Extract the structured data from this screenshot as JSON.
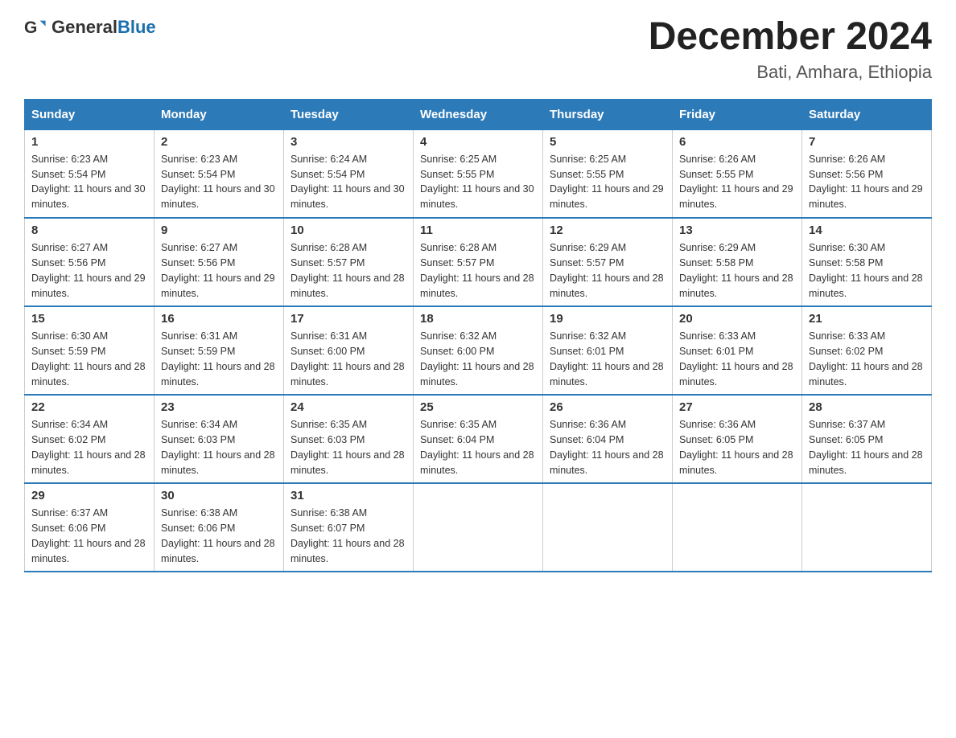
{
  "header": {
    "logo_general": "General",
    "logo_blue": "Blue",
    "month_year": "December 2024",
    "location": "Bati, Amhara, Ethiopia"
  },
  "days_of_week": [
    "Sunday",
    "Monday",
    "Tuesday",
    "Wednesday",
    "Thursday",
    "Friday",
    "Saturday"
  ],
  "weeks": [
    [
      {
        "day": "1",
        "sunrise": "6:23 AM",
        "sunset": "5:54 PM",
        "daylight": "11 hours and 30 minutes."
      },
      {
        "day": "2",
        "sunrise": "6:23 AM",
        "sunset": "5:54 PM",
        "daylight": "11 hours and 30 minutes."
      },
      {
        "day": "3",
        "sunrise": "6:24 AM",
        "sunset": "5:54 PM",
        "daylight": "11 hours and 30 minutes."
      },
      {
        "day": "4",
        "sunrise": "6:25 AM",
        "sunset": "5:55 PM",
        "daylight": "11 hours and 30 minutes."
      },
      {
        "day": "5",
        "sunrise": "6:25 AM",
        "sunset": "5:55 PM",
        "daylight": "11 hours and 29 minutes."
      },
      {
        "day": "6",
        "sunrise": "6:26 AM",
        "sunset": "5:55 PM",
        "daylight": "11 hours and 29 minutes."
      },
      {
        "day": "7",
        "sunrise": "6:26 AM",
        "sunset": "5:56 PM",
        "daylight": "11 hours and 29 minutes."
      }
    ],
    [
      {
        "day": "8",
        "sunrise": "6:27 AM",
        "sunset": "5:56 PM",
        "daylight": "11 hours and 29 minutes."
      },
      {
        "day": "9",
        "sunrise": "6:27 AM",
        "sunset": "5:56 PM",
        "daylight": "11 hours and 29 minutes."
      },
      {
        "day": "10",
        "sunrise": "6:28 AM",
        "sunset": "5:57 PM",
        "daylight": "11 hours and 28 minutes."
      },
      {
        "day": "11",
        "sunrise": "6:28 AM",
        "sunset": "5:57 PM",
        "daylight": "11 hours and 28 minutes."
      },
      {
        "day": "12",
        "sunrise": "6:29 AM",
        "sunset": "5:57 PM",
        "daylight": "11 hours and 28 minutes."
      },
      {
        "day": "13",
        "sunrise": "6:29 AM",
        "sunset": "5:58 PM",
        "daylight": "11 hours and 28 minutes."
      },
      {
        "day": "14",
        "sunrise": "6:30 AM",
        "sunset": "5:58 PM",
        "daylight": "11 hours and 28 minutes."
      }
    ],
    [
      {
        "day": "15",
        "sunrise": "6:30 AM",
        "sunset": "5:59 PM",
        "daylight": "11 hours and 28 minutes."
      },
      {
        "day": "16",
        "sunrise": "6:31 AM",
        "sunset": "5:59 PM",
        "daylight": "11 hours and 28 minutes."
      },
      {
        "day": "17",
        "sunrise": "6:31 AM",
        "sunset": "6:00 PM",
        "daylight": "11 hours and 28 minutes."
      },
      {
        "day": "18",
        "sunrise": "6:32 AM",
        "sunset": "6:00 PM",
        "daylight": "11 hours and 28 minutes."
      },
      {
        "day": "19",
        "sunrise": "6:32 AM",
        "sunset": "6:01 PM",
        "daylight": "11 hours and 28 minutes."
      },
      {
        "day": "20",
        "sunrise": "6:33 AM",
        "sunset": "6:01 PM",
        "daylight": "11 hours and 28 minutes."
      },
      {
        "day": "21",
        "sunrise": "6:33 AM",
        "sunset": "6:02 PM",
        "daylight": "11 hours and 28 minutes."
      }
    ],
    [
      {
        "day": "22",
        "sunrise": "6:34 AM",
        "sunset": "6:02 PM",
        "daylight": "11 hours and 28 minutes."
      },
      {
        "day": "23",
        "sunrise": "6:34 AM",
        "sunset": "6:03 PM",
        "daylight": "11 hours and 28 minutes."
      },
      {
        "day": "24",
        "sunrise": "6:35 AM",
        "sunset": "6:03 PM",
        "daylight": "11 hours and 28 minutes."
      },
      {
        "day": "25",
        "sunrise": "6:35 AM",
        "sunset": "6:04 PM",
        "daylight": "11 hours and 28 minutes."
      },
      {
        "day": "26",
        "sunrise": "6:36 AM",
        "sunset": "6:04 PM",
        "daylight": "11 hours and 28 minutes."
      },
      {
        "day": "27",
        "sunrise": "6:36 AM",
        "sunset": "6:05 PM",
        "daylight": "11 hours and 28 minutes."
      },
      {
        "day": "28",
        "sunrise": "6:37 AM",
        "sunset": "6:05 PM",
        "daylight": "11 hours and 28 minutes."
      }
    ],
    [
      {
        "day": "29",
        "sunrise": "6:37 AM",
        "sunset": "6:06 PM",
        "daylight": "11 hours and 28 minutes."
      },
      {
        "day": "30",
        "sunrise": "6:38 AM",
        "sunset": "6:06 PM",
        "daylight": "11 hours and 28 minutes."
      },
      {
        "day": "31",
        "sunrise": "6:38 AM",
        "sunset": "6:07 PM",
        "daylight": "11 hours and 28 minutes."
      },
      null,
      null,
      null,
      null
    ]
  ]
}
